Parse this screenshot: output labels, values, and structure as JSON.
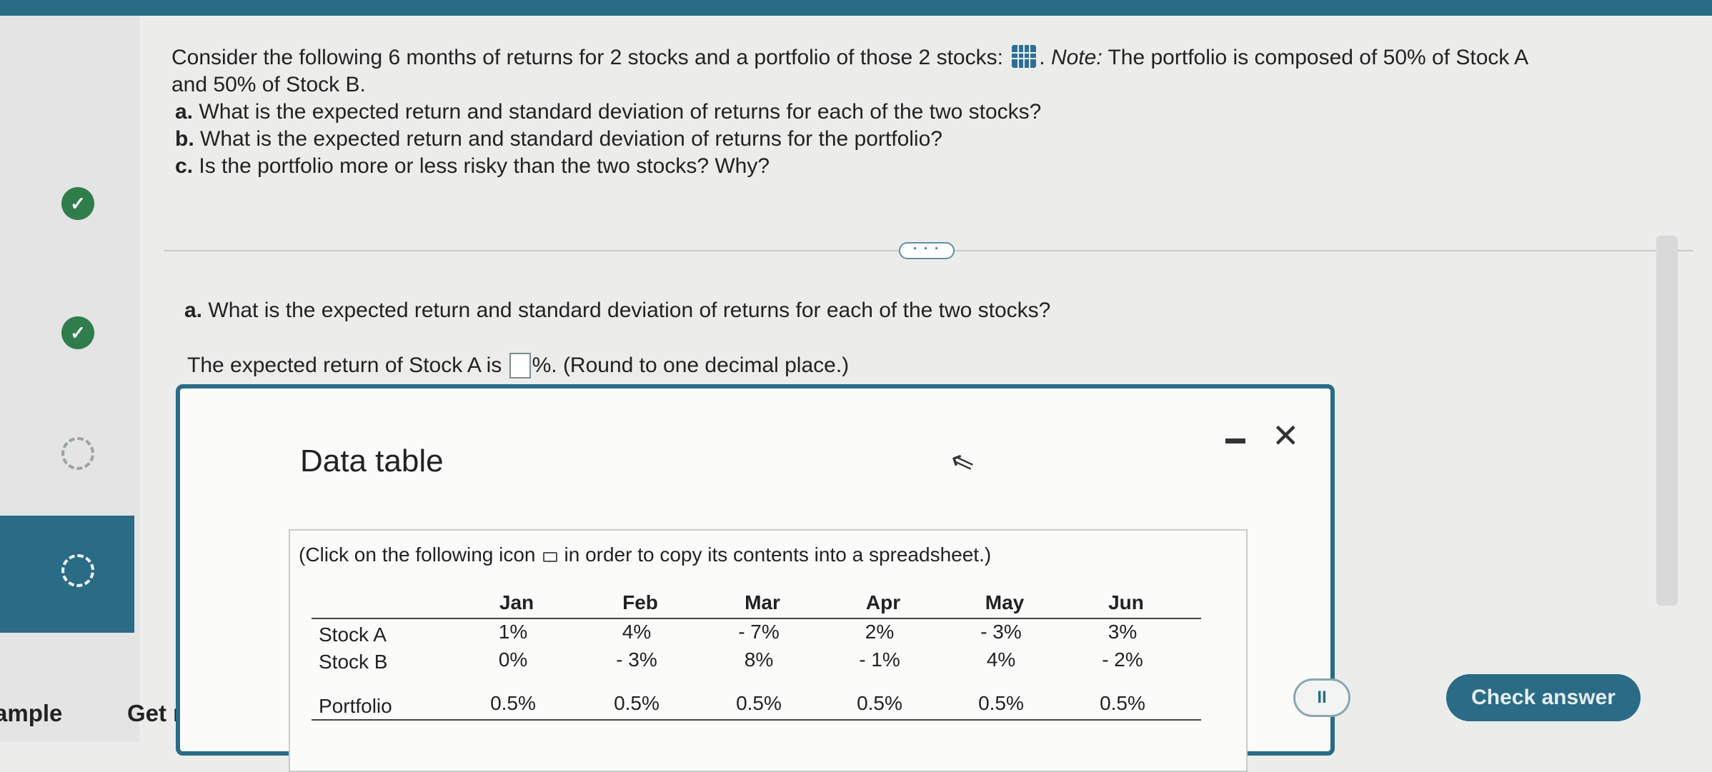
{
  "question": {
    "intro": "Consider the following 6 months of returns for 2 stocks and a portfolio of those 2 stocks:",
    "note_label": "Note:",
    "note_text": "The portfolio is composed of 50% of Stock A",
    "intro_line2": "and 50% of Stock B.",
    "parts": [
      {
        "letter": "a.",
        "text": "What is the expected return and standard deviation of returns for each of the two stocks?"
      },
      {
        "letter": "b.",
        "text": "What is the expected return and standard deviation of returns for the portfolio?"
      },
      {
        "letter": "c.",
        "text": "Is the portfolio more or less risky than the two stocks? Why?"
      }
    ]
  },
  "more_button": "· · ·",
  "subquestion": {
    "letter": "a.",
    "text": "What is the expected return and standard deviation of returns for each of the two stocks?"
  },
  "answer": {
    "prefix": "The expected return of Stock A is",
    "suffix": "%. (Round to one decimal place.)"
  },
  "dialog": {
    "title": "Data table",
    "minimize": "minimize",
    "close": "✕",
    "copy_note_before": "(Click on the following icon",
    "copy_note_after": "in order to copy its contents into a spreadsheet.)",
    "table": {
      "columns": [
        "Jan",
        "Feb",
        "Mar",
        "Apr",
        "May",
        "Jun"
      ],
      "rows": [
        {
          "label": "Stock A",
          "values": [
            "1%",
            "4%",
            "- 7%",
            "2%",
            "- 3%",
            "3%"
          ]
        },
        {
          "label": "Stock B",
          "values": [
            "0%",
            "- 3%",
            "8%",
            "- 1%",
            "4%",
            "- 2%"
          ]
        },
        {
          "label": "Portfolio",
          "values": [
            "0.5%",
            "0.5%",
            "0.5%",
            "0.5%",
            "0.5%",
            "0.5%"
          ]
        }
      ]
    }
  },
  "sidebar": {
    "bottom_left": "ample",
    "bottom_right": "Get n"
  },
  "footer": {
    "pause": "II",
    "check_answer": "Check answer"
  }
}
